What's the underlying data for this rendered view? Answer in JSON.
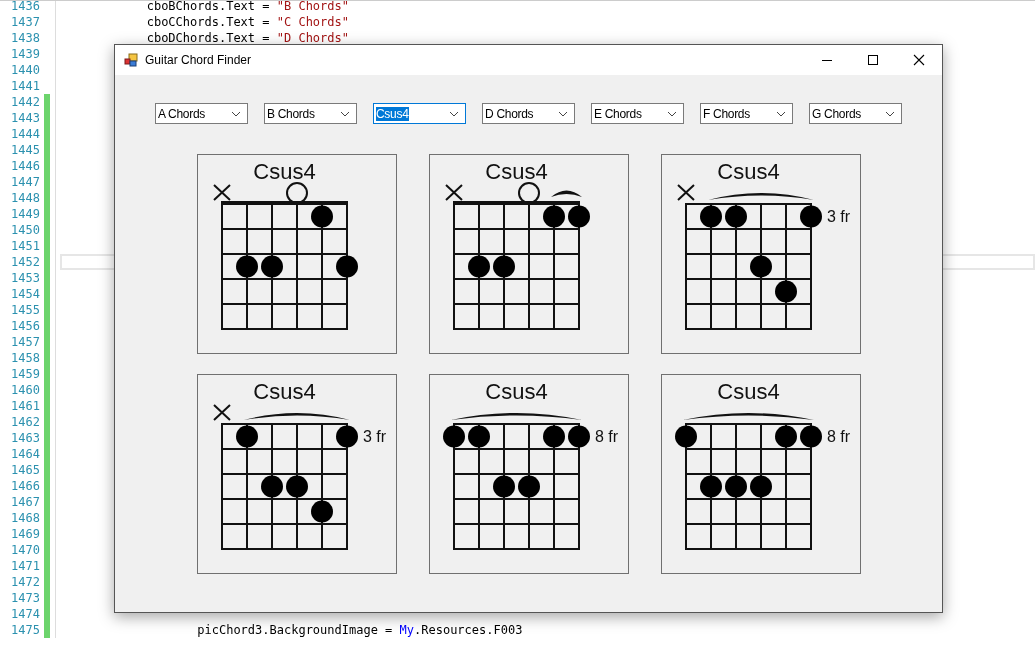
{
  "editor": {
    "lines": [
      {
        "number": "1436",
        "changed": false,
        "code": [
          {
            "text": "            cboBChords.Text = ",
            "kind": "plain"
          },
          {
            "text": "\"B Chords\"",
            "kind": "string"
          }
        ]
      },
      {
        "number": "1437",
        "changed": false,
        "code": [
          {
            "text": "            cboCChords.Text = ",
            "kind": "plain"
          },
          {
            "text": "\"C Chords\"",
            "kind": "string"
          }
        ]
      },
      {
        "number": "1438",
        "changed": false,
        "code": [
          {
            "text": "            cboDChords.Text = ",
            "kind": "plain"
          },
          {
            "text": "\"D Chords\"",
            "kind": "string"
          }
        ]
      },
      {
        "number": "1439",
        "changed": false
      },
      {
        "number": "1440",
        "changed": false
      },
      {
        "number": "1441",
        "changed": false
      },
      {
        "number": "1442",
        "changed": true
      },
      {
        "number": "1443",
        "changed": true
      },
      {
        "number": "1444",
        "changed": true
      },
      {
        "number": "1445",
        "changed": true
      },
      {
        "number": "1446",
        "changed": true
      },
      {
        "number": "1447",
        "changed": true
      },
      {
        "number": "1448",
        "changed": true
      },
      {
        "number": "1449",
        "changed": true
      },
      {
        "number": "1450",
        "changed": true
      },
      {
        "number": "1451",
        "changed": true
      },
      {
        "number": "1452",
        "changed": true,
        "current": true
      },
      {
        "number": "1453",
        "changed": true
      },
      {
        "number": "1454",
        "changed": true
      },
      {
        "number": "1455",
        "changed": true
      },
      {
        "number": "1456",
        "changed": true
      },
      {
        "number": "1457",
        "changed": true
      },
      {
        "number": "1458",
        "changed": true
      },
      {
        "number": "1459",
        "changed": true
      },
      {
        "number": "1460",
        "changed": true
      },
      {
        "number": "1461",
        "changed": true
      },
      {
        "number": "1462",
        "changed": true
      },
      {
        "number": "1463",
        "changed": true
      },
      {
        "number": "1464",
        "changed": true
      },
      {
        "number": "1465",
        "changed": true
      },
      {
        "number": "1466",
        "changed": true
      },
      {
        "number": "1467",
        "changed": true
      },
      {
        "number": "1468",
        "changed": true
      },
      {
        "number": "1469",
        "changed": true
      },
      {
        "number": "1470",
        "changed": true
      },
      {
        "number": "1471",
        "changed": true
      },
      {
        "number": "1472",
        "changed": true
      },
      {
        "number": "1473",
        "changed": true
      },
      {
        "number": "1474",
        "changed": true
      },
      {
        "number": "1475",
        "changed": true,
        "code": [
          {
            "text": "                   picChord3.BackgroundImage = ",
            "kind": "plain"
          },
          {
            "text": "My",
            "kind": "keyword"
          },
          {
            "text": ".Resources.F003",
            "kind": "plain"
          }
        ]
      }
    ]
  },
  "window": {
    "title": "Guitar Chord Finder"
  },
  "combos": [
    {
      "value": "A Chords",
      "selected": false
    },
    {
      "value": "B Chords",
      "selected": false
    },
    {
      "value": "Csus4",
      "selected": true
    },
    {
      "value": "D Chords",
      "selected": false
    },
    {
      "value": "E Chords",
      "selected": false
    },
    {
      "value": "F Chords",
      "selected": false
    },
    {
      "value": "G Chords",
      "selected": false
    }
  ],
  "chords": [
    {
      "name": "Csus4",
      "nut": true,
      "strings": [
        {
          "kind": "muted",
          "dots": [
            false,
            false,
            false,
            false,
            false
          ]
        },
        {
          "kind": "fretted",
          "dots": [
            false,
            false,
            true,
            false,
            false
          ]
        },
        {
          "kind": "fretted",
          "dots": [
            false,
            false,
            true,
            false,
            false
          ]
        },
        {
          "kind": "open",
          "dots": [
            false,
            false,
            false,
            false,
            false
          ]
        },
        {
          "kind": "fretted",
          "dots": [
            true,
            false,
            false,
            false,
            false
          ]
        },
        {
          "kind": "fretted",
          "dots": [
            false,
            false,
            true,
            false,
            false
          ]
        }
      ]
    },
    {
      "name": "Csus4",
      "nut": true,
      "barre": {
        "kind": "top_pair"
      },
      "strings": [
        {
          "kind": "muted",
          "dots": [
            false,
            false,
            false,
            false,
            false
          ]
        },
        {
          "kind": "fretted",
          "dots": [
            false,
            false,
            true,
            false,
            false
          ]
        },
        {
          "kind": "fretted",
          "dots": [
            false,
            false,
            true,
            false,
            false
          ]
        },
        {
          "kind": "open",
          "dots": [
            false,
            false,
            false,
            false,
            false
          ]
        },
        {
          "kind": "fretted",
          "dots": [
            true,
            false,
            false,
            false,
            false
          ]
        },
        {
          "kind": "fretted",
          "dots": [
            true,
            false,
            false,
            false,
            false
          ]
        }
      ]
    },
    {
      "name": "Csus4",
      "nut": false,
      "fret_label": "3 fr",
      "barre": {
        "kind": "five_strings"
      },
      "strings": [
        {
          "kind": "muted",
          "dots": [
            false,
            false,
            false,
            false,
            false
          ]
        },
        {
          "kind": "fretted",
          "dots": [
            true,
            false,
            false,
            false,
            false
          ]
        },
        {
          "kind": "fretted",
          "dots": [
            true,
            false,
            false,
            false,
            false
          ]
        },
        {
          "kind": "fretted",
          "dots": [
            false,
            false,
            true,
            false,
            false
          ]
        },
        {
          "kind": "fretted",
          "dots": [
            false,
            false,
            false,
            true,
            false
          ]
        },
        {
          "kind": "fretted",
          "dots": [
            true,
            false,
            false,
            false,
            false
          ]
        }
      ]
    },
    {
      "name": "Csus4",
      "nut": false,
      "fret_label": "3 fr",
      "barre": {
        "kind": "five_strings"
      },
      "strings": [
        {
          "kind": "muted",
          "dots": [
            false,
            false,
            false,
            false,
            false
          ]
        },
        {
          "kind": "fretted",
          "dots": [
            true,
            false,
            false,
            false,
            false
          ]
        },
        {
          "kind": "fretted",
          "dots": [
            false,
            false,
            true,
            false,
            false
          ]
        },
        {
          "kind": "fretted",
          "dots": [
            false,
            false,
            true,
            false,
            false
          ]
        },
        {
          "kind": "fretted",
          "dots": [
            false,
            false,
            false,
            true,
            false
          ]
        },
        {
          "kind": "fretted",
          "dots": [
            true,
            false,
            false,
            false,
            false
          ]
        }
      ]
    },
    {
      "name": "Csus4",
      "nut": false,
      "fret_label": "8 fr",
      "barre": {
        "kind": "six_strings"
      },
      "strings": [
        {
          "kind": "fretted",
          "dots": [
            true,
            false,
            false,
            false,
            false
          ]
        },
        {
          "kind": "fretted",
          "dots": [
            true,
            false,
            false,
            false,
            false
          ]
        },
        {
          "kind": "fretted",
          "dots": [
            false,
            false,
            true,
            false,
            false
          ]
        },
        {
          "kind": "fretted",
          "dots": [
            false,
            false,
            true,
            false,
            false
          ]
        },
        {
          "kind": "fretted",
          "dots": [
            true,
            false,
            false,
            false,
            false
          ]
        },
        {
          "kind": "fretted",
          "dots": [
            true,
            false,
            false,
            false,
            false
          ]
        }
      ]
    },
    {
      "name": "Csus4",
      "nut": false,
      "fret_label": "8 fr",
      "barre": {
        "kind": "six_strings"
      },
      "strings": [
        {
          "kind": "fretted",
          "dots": [
            true,
            false,
            false,
            false,
            false
          ]
        },
        {
          "kind": "fretted",
          "dots": [
            false,
            false,
            true,
            false,
            false
          ]
        },
        {
          "kind": "fretted",
          "dots": [
            false,
            false,
            true,
            false,
            false
          ]
        },
        {
          "kind": "fretted",
          "dots": [
            false,
            false,
            true,
            false,
            false
          ]
        },
        {
          "kind": "fretted",
          "dots": [
            true,
            false,
            false,
            false,
            false
          ]
        },
        {
          "kind": "fretted",
          "dots": [
            true,
            false,
            false,
            false,
            false
          ]
        }
      ]
    }
  ]
}
